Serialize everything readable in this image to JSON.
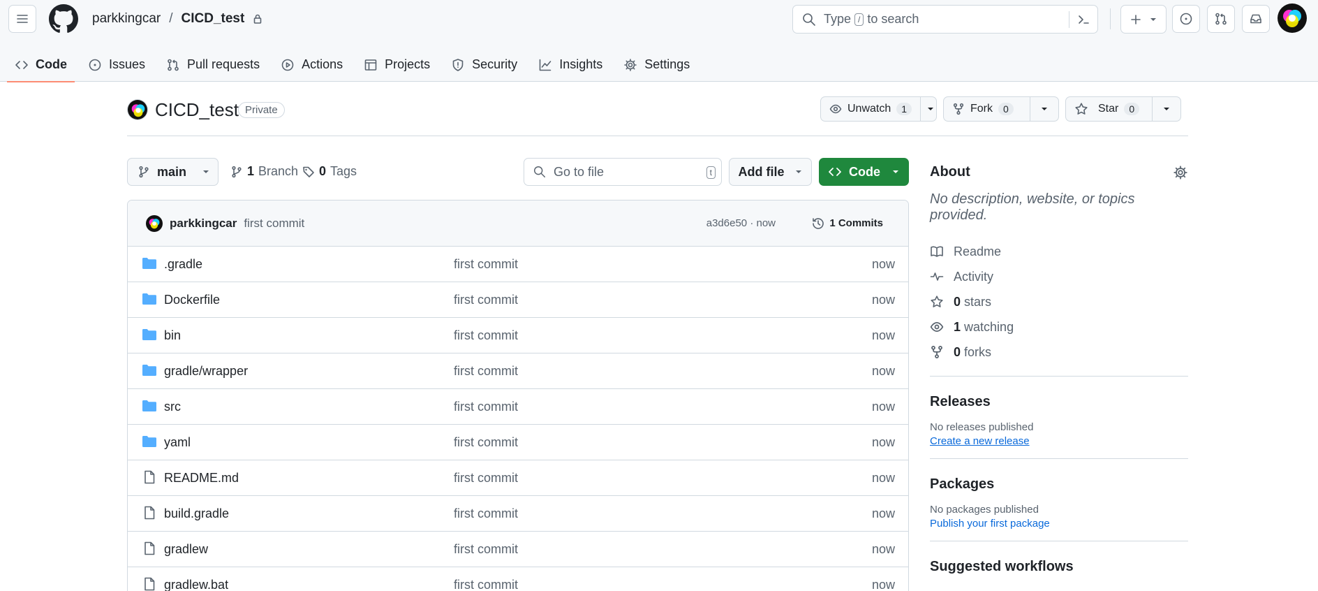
{
  "header": {
    "owner": "parkkingcar",
    "separator": "/",
    "repo": "CICD_test",
    "search_prefix": "Type",
    "search_key": "/",
    "search_suffix": "to search"
  },
  "tabs": [
    {
      "label": "Code"
    },
    {
      "label": "Issues"
    },
    {
      "label": "Pull requests"
    },
    {
      "label": "Actions"
    },
    {
      "label": "Projects"
    },
    {
      "label": "Security"
    },
    {
      "label": "Insights"
    },
    {
      "label": "Settings"
    }
  ],
  "repo": {
    "name": "CICD_test",
    "visibility": "Private",
    "unwatch_label": "Unwatch",
    "watch_count": "1",
    "fork_label": "Fork",
    "fork_count": "0",
    "star_label": "Star",
    "star_count": "0"
  },
  "filenav": {
    "branch": "main",
    "branch_count": "1",
    "branch_label": "Branch",
    "tag_count": "0",
    "tag_label": "Tags",
    "goto_placeholder": "Go to file",
    "goto_key": "t",
    "add_file": "Add file",
    "code": "Code"
  },
  "commit": {
    "author": "parkkingcar",
    "message": "first commit",
    "sha_time": "a3d6e50 · now",
    "commits_label": "1 Commits"
  },
  "files": [
    {
      "name": ".gradle",
      "type": "dir",
      "message": "first commit",
      "date": "now"
    },
    {
      "name": "Dockerfile",
      "type": "dir",
      "message": "first commit",
      "date": "now"
    },
    {
      "name": "bin",
      "type": "dir",
      "message": "first commit",
      "date": "now"
    },
    {
      "name": "gradle/wrapper",
      "type": "dir",
      "message": "first commit",
      "date": "now"
    },
    {
      "name": "src",
      "type": "dir",
      "message": "first commit",
      "date": "now"
    },
    {
      "name": "yaml",
      "type": "dir",
      "message": "first commit",
      "date": "now"
    },
    {
      "name": "README.md",
      "type": "file",
      "message": "first commit",
      "date": "now"
    },
    {
      "name": "build.gradle",
      "type": "file",
      "message": "first commit",
      "date": "now"
    },
    {
      "name": "gradlew",
      "type": "file",
      "message": "first commit",
      "date": "now"
    },
    {
      "name": "gradlew.bat",
      "type": "file",
      "message": "first commit",
      "date": "now"
    }
  ],
  "about": {
    "title": "About",
    "description": "No description, website, or topics provided.",
    "readme": "Readme",
    "activity": "Activity",
    "stars_count": "0",
    "stars_label": "stars",
    "watching_count": "1",
    "watching_label": "watching",
    "forks_count": "0",
    "forks_label": "forks"
  },
  "releases": {
    "title": "Releases",
    "empty": "No releases published",
    "link": "Create a new release"
  },
  "packages": {
    "title": "Packages",
    "empty": "No packages published",
    "link": "Publish your first package"
  },
  "workflows": {
    "title": "Suggested workflows"
  },
  "colors": {
    "primary_button": "#1f883d",
    "link": "#0969da",
    "folder": "#54aeff",
    "active_tab_underline": "#fd8c73"
  }
}
